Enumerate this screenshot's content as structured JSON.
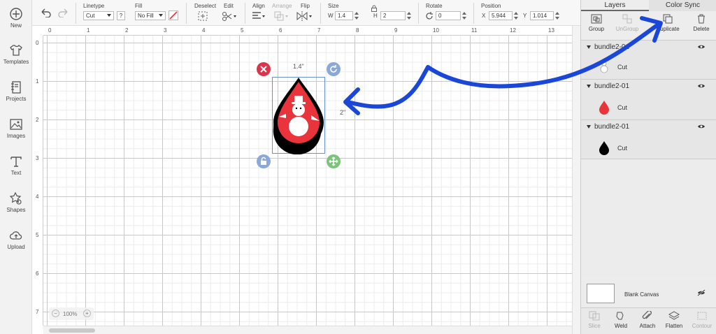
{
  "sidebar": {
    "items": [
      {
        "label": "New",
        "icon": "plus-circle-icon"
      },
      {
        "label": "Templates",
        "icon": "shirt-icon"
      },
      {
        "label": "Projects",
        "icon": "notebook-icon"
      },
      {
        "label": "Images",
        "icon": "image-icon"
      },
      {
        "label": "Text",
        "icon": "text-icon"
      },
      {
        "label": "Shapes",
        "icon": "shapes-icon"
      },
      {
        "label": "Upload",
        "icon": "cloud-upload-icon"
      }
    ]
  },
  "toolbar": {
    "linetype_label": "Linetype",
    "linetype_value": "Cut",
    "linetype_help": "?",
    "fill_label": "Fill",
    "fill_value": "No Fill",
    "deselect_label": "Deselect",
    "edit_label": "Edit",
    "align_label": "Align",
    "arrange_label": "Arrange",
    "flip_label": "Flip",
    "size_label": "Size",
    "width_prefix": "W",
    "width_value": "1.4",
    "height_prefix": "H",
    "height_value": "2",
    "rotate_label": "Rotate",
    "rotate_value": "0",
    "position_label": "Position",
    "x_prefix": "X",
    "x_value": "5.944",
    "y_prefix": "Y",
    "y_value": "1.014"
  },
  "rulers": {
    "top": [
      "0",
      "1",
      "2",
      "3",
      "4",
      "5",
      "6",
      "7",
      "8",
      "9",
      "10",
      "11",
      "12",
      "13"
    ],
    "left": [
      "0",
      "1",
      "2",
      "3",
      "4",
      "5",
      "6",
      "7"
    ]
  },
  "canvas": {
    "selection_width": "1.4\"",
    "selection_height": "2\"",
    "zoom": "100%"
  },
  "panel": {
    "tabs": [
      "Layers",
      "Color Sync"
    ],
    "actions": [
      {
        "label": "Group",
        "enabled": true
      },
      {
        "label": "UnGroup",
        "enabled": false
      },
      {
        "label": "Duplicate",
        "enabled": true
      },
      {
        "label": "Delete",
        "enabled": true
      }
    ],
    "layers": [
      {
        "name": "bundle2-01",
        "item": "Cut",
        "thumb": "snowman-icon"
      },
      {
        "name": "bundle2-01",
        "item": "Cut",
        "thumb": "red-drop-icon"
      },
      {
        "name": "bundle2-01",
        "item": "Cut",
        "thumb": "black-drop-icon"
      }
    ],
    "blank_canvas": "Blank Canvas",
    "bottom_actions": [
      {
        "label": "Slice",
        "enabled": false
      },
      {
        "label": "Weld",
        "enabled": true
      },
      {
        "label": "Attach",
        "enabled": true
      },
      {
        "label": "Flatten",
        "enabled": true
      },
      {
        "label": "Contour",
        "enabled": false
      }
    ]
  },
  "colors": {
    "accent_arrow": "#1a47d8",
    "design_red": "#e8343a",
    "delete_handle": "#d9364c",
    "rotate_handle": "#8aa8d8",
    "scale_handle": "#7cc47a"
  }
}
